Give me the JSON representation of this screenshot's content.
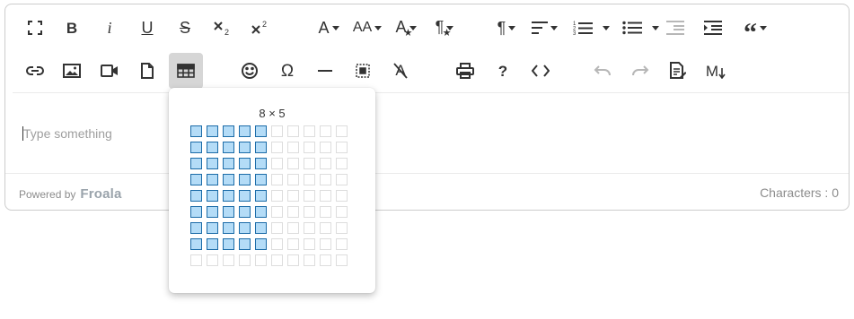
{
  "toolbar": {
    "row1": [
      {
        "name": "fullscreen-button",
        "icon": "fullscreen-icon"
      },
      {
        "name": "bold-button",
        "icon": "bold-icon",
        "text": "B"
      },
      {
        "name": "italic-button",
        "icon": "italic-icon",
        "text": "i"
      },
      {
        "name": "underline-button",
        "icon": "underline-icon",
        "text": "U"
      },
      {
        "name": "strikethrough-button",
        "icon": "strikethrough-icon",
        "text": "S"
      },
      {
        "name": "subscript-button",
        "icon": "subscript-icon"
      },
      {
        "name": "superscript-button",
        "icon": "superscript-icon"
      },
      {
        "name": "font-family-button",
        "icon": "font-family-icon",
        "text": "A",
        "dropdown": true
      },
      {
        "name": "font-size-button",
        "icon": "font-size-icon",
        "text": "AA",
        "dropdown": true
      },
      {
        "name": "text-color-button",
        "icon": "text-color-icon",
        "text": "A",
        "dropdown": true
      },
      {
        "name": "paragraph-style-button",
        "icon": "paragraph-style-icon",
        "text": "¶",
        "dropdown": true
      },
      {
        "name": "paragraph-format-button",
        "icon": "paragraph-format-icon",
        "text": "¶",
        "dropdown": true
      },
      {
        "name": "align-button",
        "icon": "align-left-icon",
        "dropdown": true
      },
      {
        "name": "ordered-list-button",
        "icon": "ordered-list-icon",
        "dropdown": true
      },
      {
        "name": "unordered-list-button",
        "icon": "unordered-list-icon",
        "dropdown": true
      },
      {
        "name": "outdent-button",
        "icon": "outdent-icon",
        "disabled": true
      },
      {
        "name": "indent-button",
        "icon": "indent-icon"
      },
      {
        "name": "quote-button",
        "icon": "quote-icon",
        "dropdown": true
      }
    ],
    "row2": [
      {
        "name": "insert-link-button",
        "icon": "link-icon"
      },
      {
        "name": "insert-image-button",
        "icon": "image-icon"
      },
      {
        "name": "insert-video-button",
        "icon": "video-icon"
      },
      {
        "name": "insert-file-button",
        "icon": "file-icon"
      },
      {
        "name": "insert-table-button",
        "icon": "table-icon",
        "active": true
      },
      {
        "name": "emoticons-button",
        "icon": "smiley-icon"
      },
      {
        "name": "special-characters-button",
        "icon": "omega-icon",
        "text": "Ω"
      },
      {
        "name": "horizontal-line-button",
        "icon": "horizontal-line-icon"
      },
      {
        "name": "select-all-button",
        "icon": "select-all-icon"
      },
      {
        "name": "clear-formatting-button",
        "icon": "clear-formatting-icon"
      },
      {
        "name": "print-button",
        "icon": "print-icon"
      },
      {
        "name": "help-button",
        "icon": "help-icon",
        "text": "?"
      },
      {
        "name": "code-view-button",
        "icon": "code-icon"
      },
      {
        "name": "undo-button",
        "icon": "undo-icon",
        "disabled": true
      },
      {
        "name": "redo-button",
        "icon": "redo-icon",
        "disabled": true
      },
      {
        "name": "edit-document-button",
        "icon": "document-edit-icon"
      },
      {
        "name": "markdown-button",
        "icon": "markdown-icon"
      }
    ]
  },
  "editor": {
    "placeholder": "Type something"
  },
  "footer": {
    "powered_by": "Powered by",
    "brand": "Froala",
    "characters": "Characters : 0"
  },
  "table_popup": {
    "size_label": "8 × 5",
    "columns": 10,
    "rows": 9,
    "selected_columns": 5,
    "selected_rows": 8
  },
  "colors": {
    "selected_cell_fill": "#b4dcf7",
    "selected_cell_border": "#1c6ca8",
    "active_button": "#d6d6d6"
  }
}
